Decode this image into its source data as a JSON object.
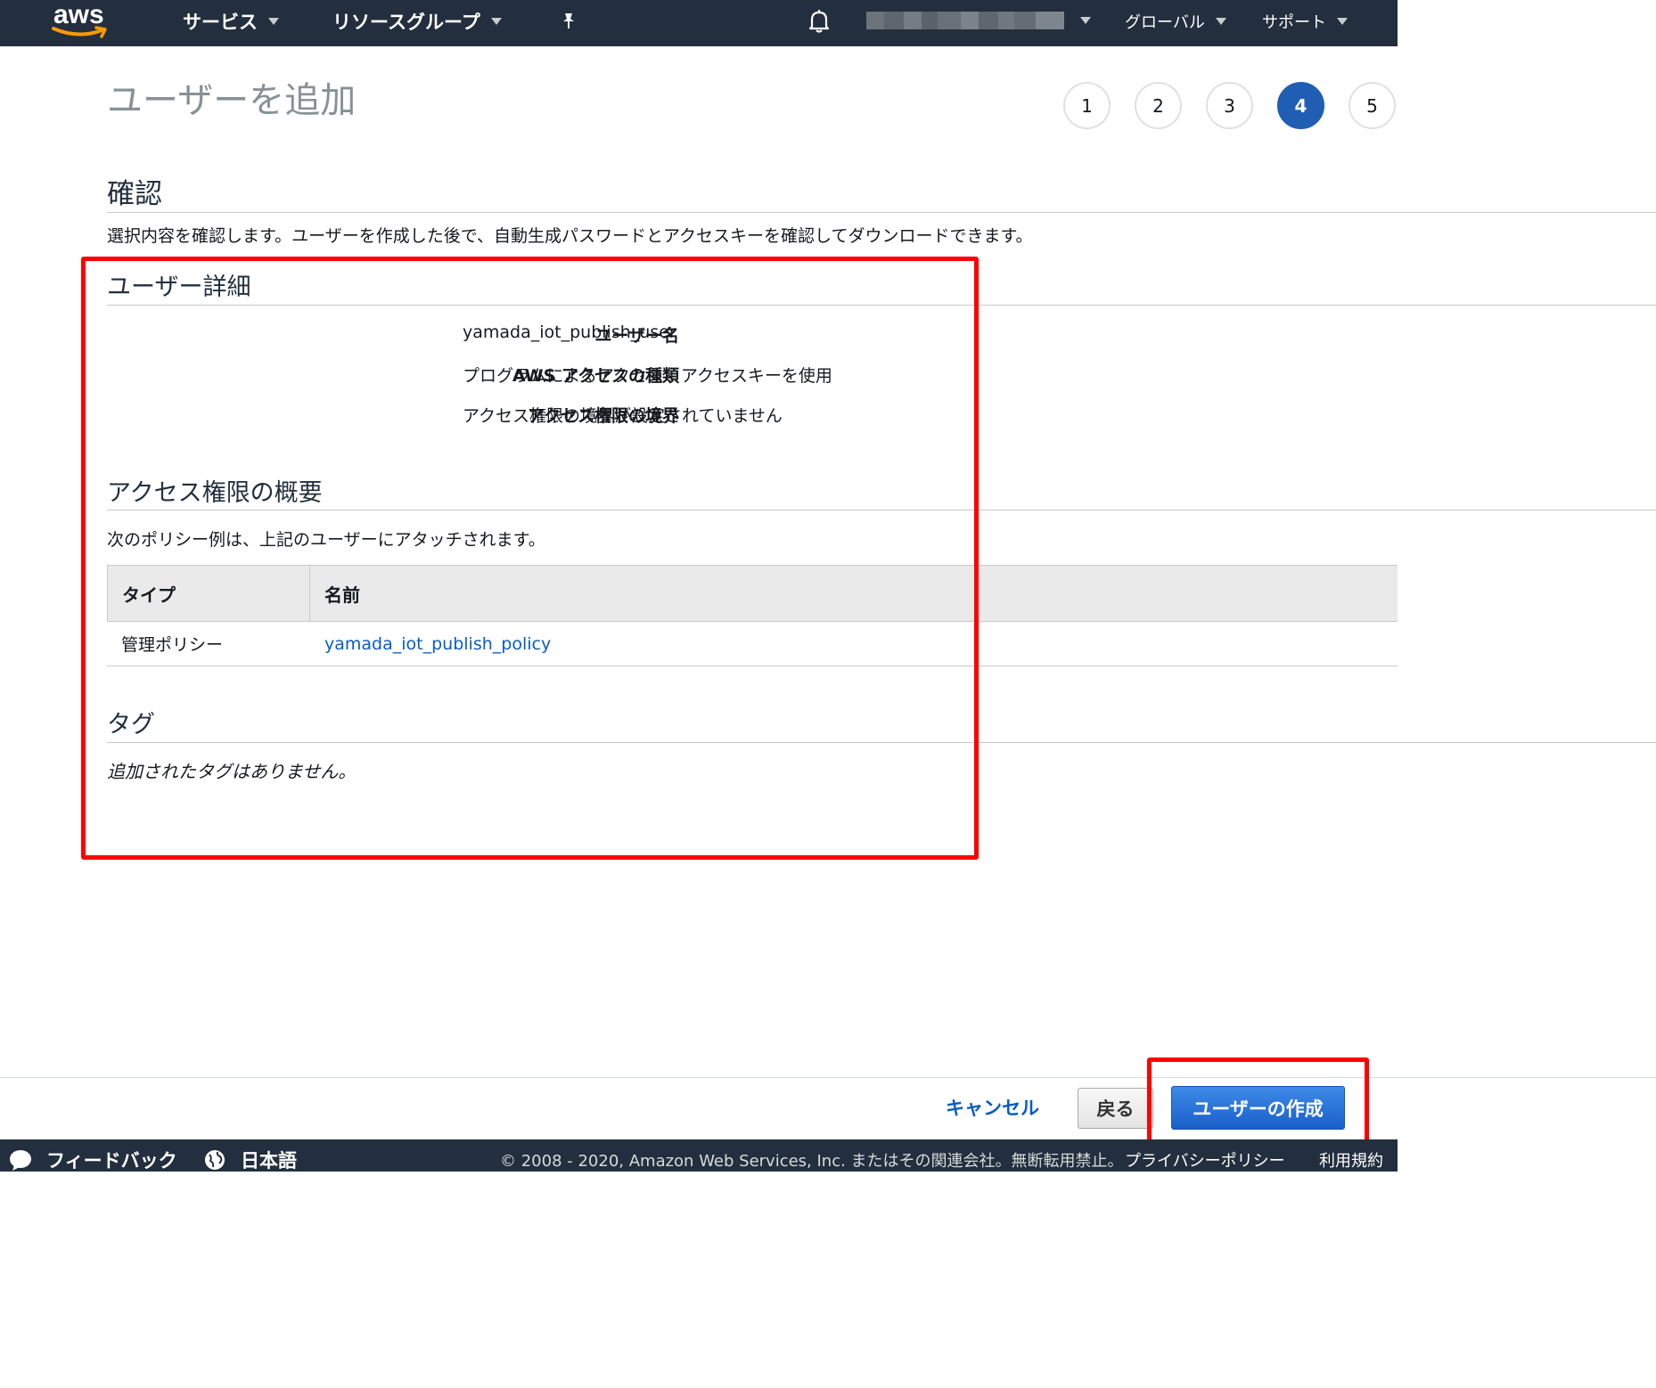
{
  "topnav": {
    "logo_text": "aws",
    "services": "サービス",
    "resource_groups": "リソースグループ",
    "region": "グローバル",
    "support": "サポート"
  },
  "page": {
    "title": "ユーザーを追加",
    "steps": [
      "1",
      "2",
      "3",
      "4",
      "5"
    ],
    "active_step": "4"
  },
  "review": {
    "heading": "確認",
    "description": "選択内容を確認します。ユーザーを作成した後で、自動生成パスワードとアクセスキーを確認してダウンロードできます。"
  },
  "user_details": {
    "heading": "ユーザー詳細",
    "rows": [
      {
        "label": "ユーザー名",
        "value": "yamada_iot_publish_user"
      },
      {
        "label": "AWS アクセスの種類",
        "value": "プログラムによるアクセス - アクセスキーを使用"
      },
      {
        "label": "アクセス権限の境界",
        "value": "アクセス権限の境界が設定されていません"
      }
    ]
  },
  "permissions": {
    "heading": "アクセス権限の概要",
    "description": "次のポリシー例は、上記のユーザーにアタッチされます。",
    "columns": [
      "タイプ",
      "名前"
    ],
    "rows": [
      {
        "type": "管理ポリシー",
        "name": "yamada_iot_publish_policy"
      }
    ]
  },
  "tags": {
    "heading": "タグ",
    "empty_text": "追加されたタグはありません。"
  },
  "actions": {
    "cancel": "キャンセル",
    "back": "戻る",
    "create": "ユーザーの作成"
  },
  "footer": {
    "feedback": "フィードバック",
    "language": "日本語",
    "copyright": "© 2008 - 2020, Amazon Web Services, Inc. またはその関連会社。無断転用禁止。",
    "privacy": "プライバシーポリシー",
    "terms": "利用規約"
  },
  "colors": {
    "nav_bg": "#232f3e",
    "active_step": "#1f5eb3",
    "link": "#0a5cc2",
    "primary_button": "#1a5fc9",
    "annotation": "#ff0000"
  }
}
